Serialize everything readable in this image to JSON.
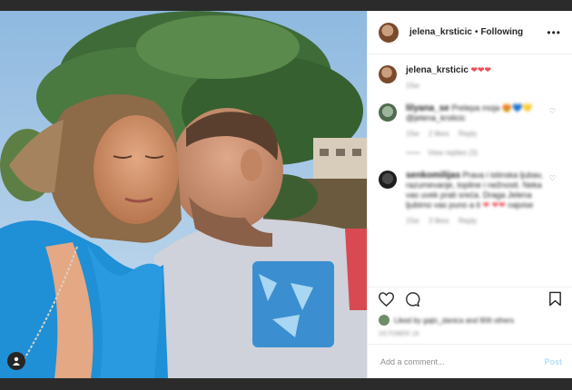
{
  "post": {
    "author": "jelena_krsticic",
    "separator": "•",
    "follow_label": "Following",
    "more_icon": "more-icon",
    "caption_user": "jelena_krsticic",
    "caption_hearts": "❤❤❤",
    "caption_time": "15w"
  },
  "comments": [
    {
      "user": "lilyana_se",
      "text": "Prelepa moja 😍💙💛 @jelena_krsticic",
      "time": "15w",
      "likes": "2 likes",
      "reply": "Reply",
      "view_replies": "View replies (3)"
    },
    {
      "user": "senkomilijas",
      "text": "Prava i istinska ljubav, razumevanje, topline i nežnosti. Neka vas uvek prati sreća. Draga Jelena ljubimo vas puno a ti",
      "text_end": "najvise",
      "time": "15w",
      "likes": "3 likes",
      "reply": "Reply"
    }
  ],
  "likes": {
    "text": "Liked by gajic_danica and 906 others",
    "date": "OCTOBER 18"
  },
  "add_comment": {
    "placeholder": "Add a comment...",
    "post_label": "Post"
  },
  "colors": {
    "link": "#00376b",
    "post_button": "#b2dffc",
    "heart": "#ed4956"
  }
}
